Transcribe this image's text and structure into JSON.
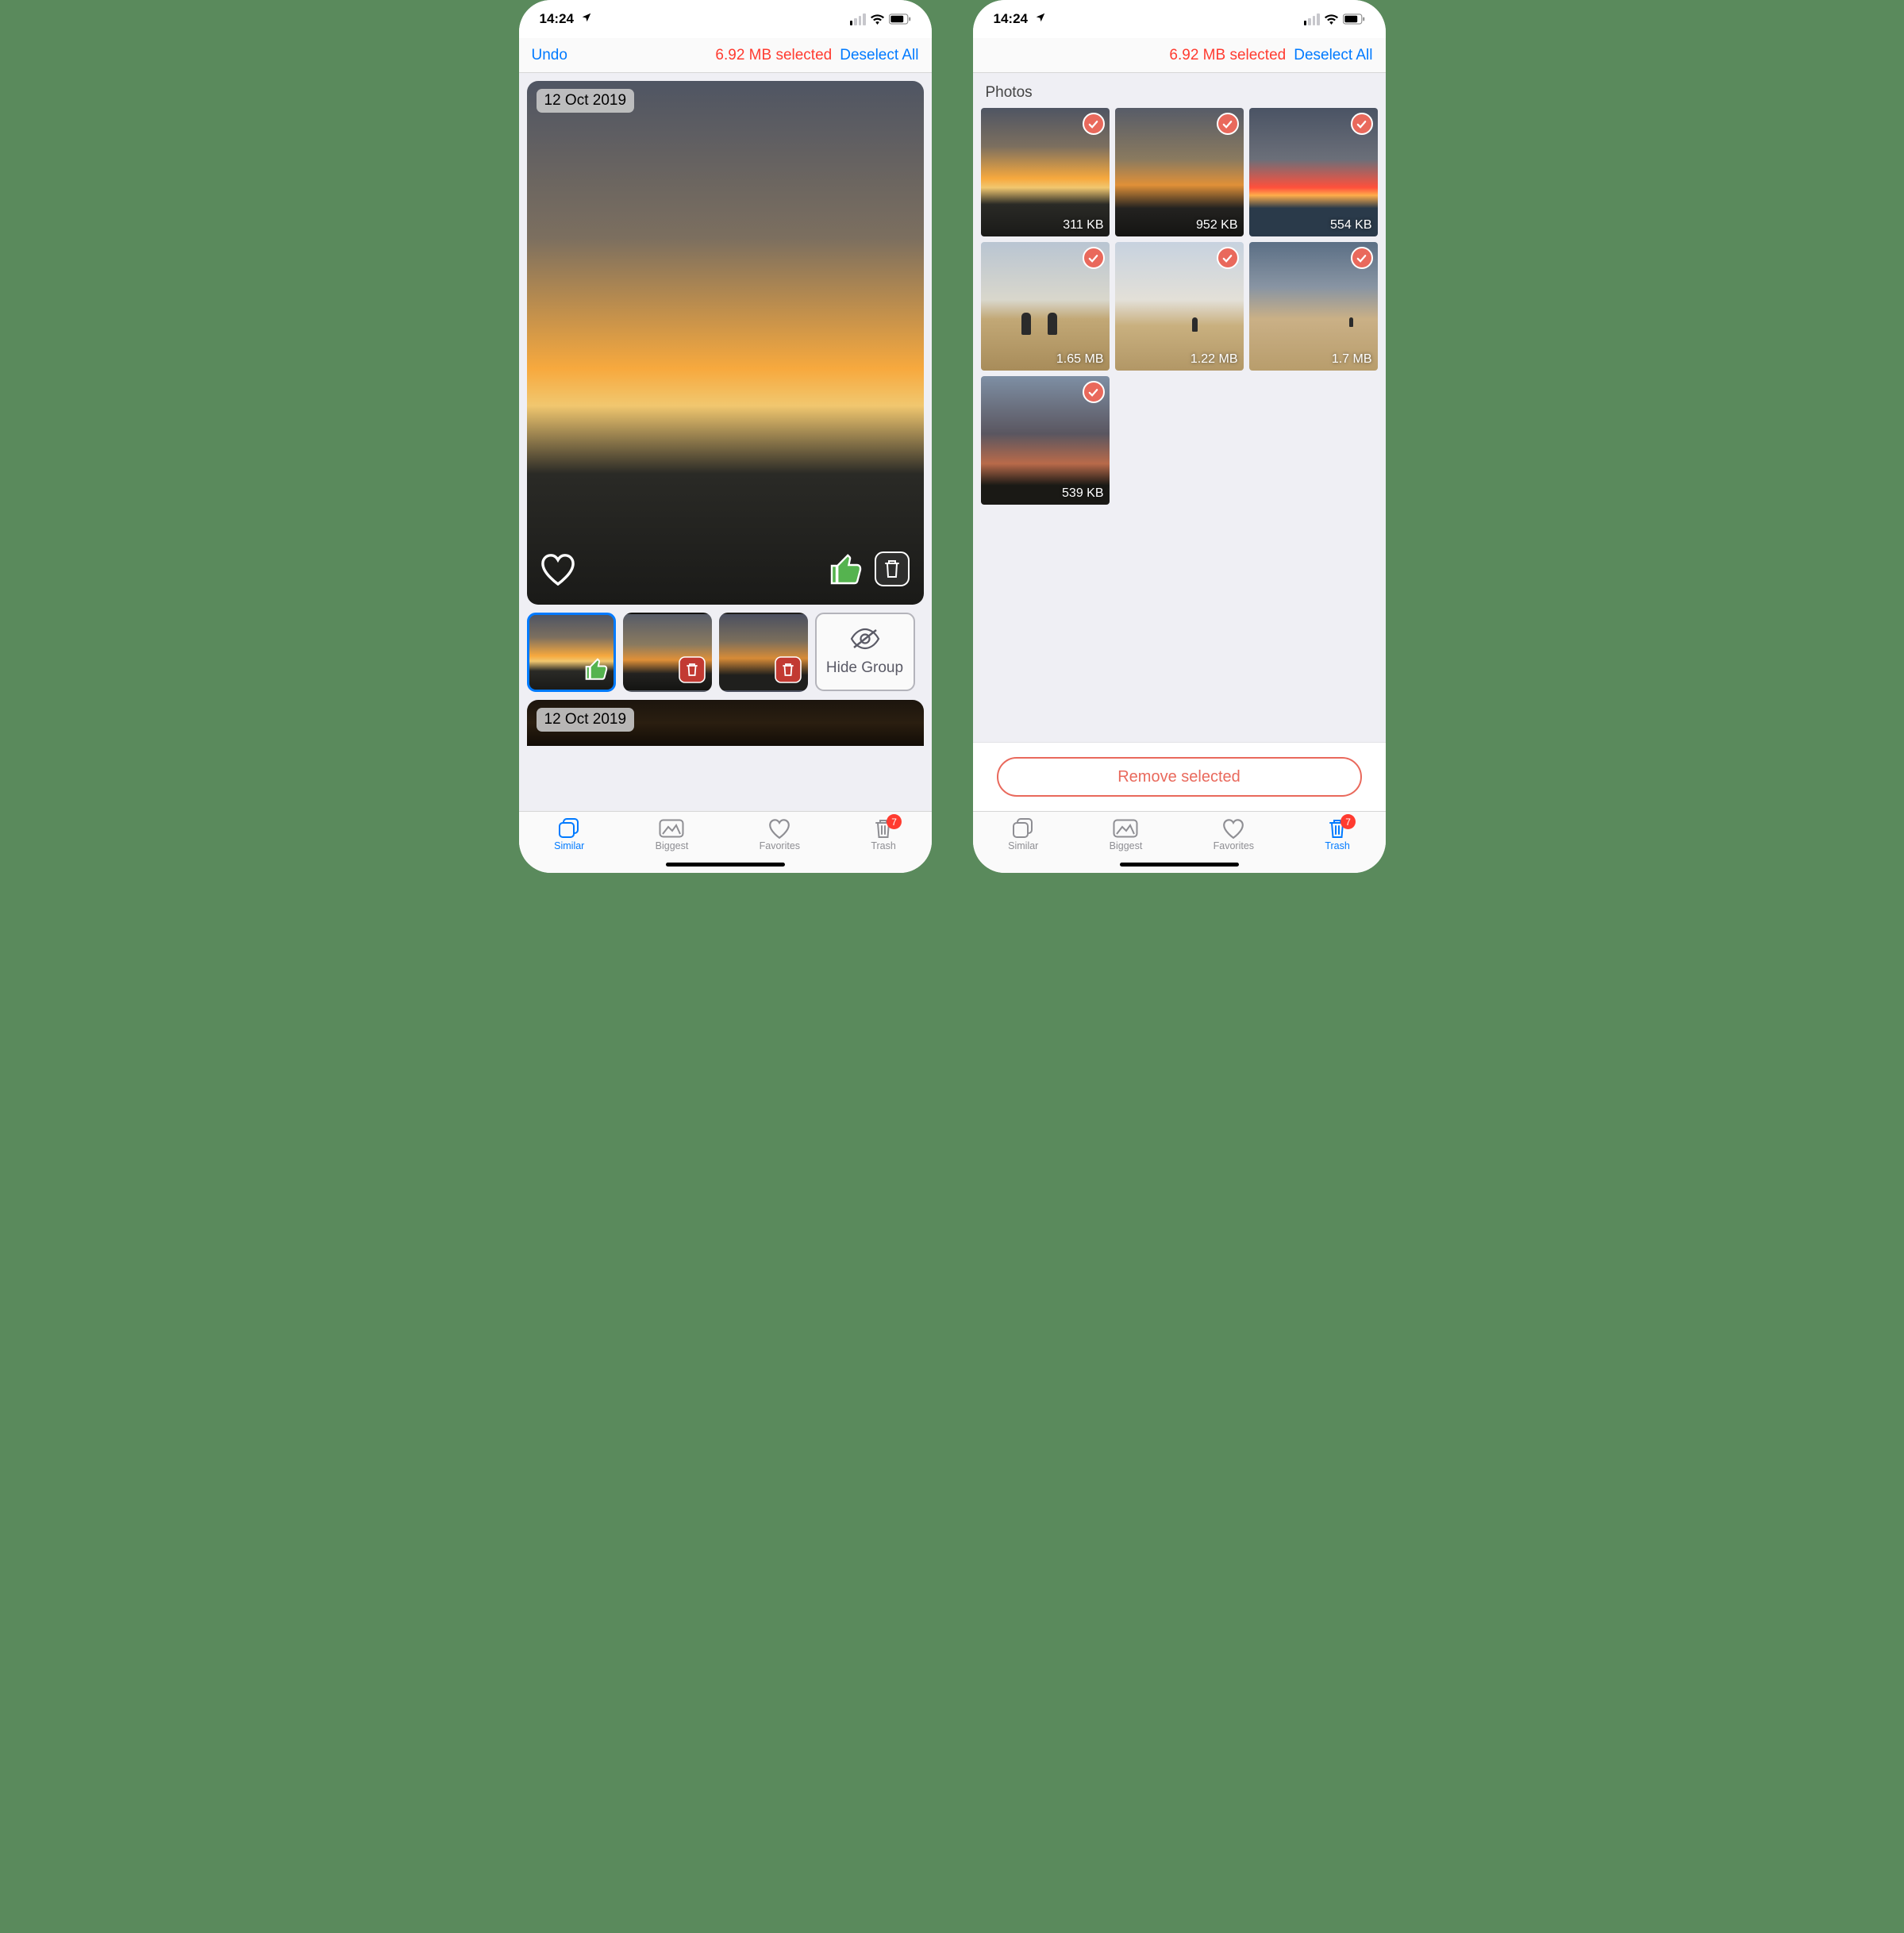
{
  "status": {
    "time": "14:24",
    "signal_bars_on": 1,
    "signal_bars_total": 4
  },
  "left": {
    "undo": "Undo",
    "selected_summary": "6.92 MB selected",
    "deselect": "Deselect All",
    "group1_date": "12 Oct 2019",
    "hide_group": "Hide Group",
    "group2_date": "12 Oct 2019",
    "thumbs": [
      {
        "state": "keep"
      },
      {
        "state": "trash"
      },
      {
        "state": "trash"
      }
    ]
  },
  "right": {
    "selected_summary": "6.92 MB selected",
    "deselect": "Deselect All",
    "section": "Photos",
    "remove_label": "Remove selected",
    "items": [
      {
        "size": "311 KB"
      },
      {
        "size": "952 KB"
      },
      {
        "size": "554 KB"
      },
      {
        "size": "1.65 MB"
      },
      {
        "size": "1.22 MB"
      },
      {
        "size": "1.7 MB"
      },
      {
        "size": "539 KB"
      }
    ]
  },
  "tabs": {
    "similar": "Similar",
    "biggest": "Biggest",
    "favorites": "Favorites",
    "trash": "Trash",
    "trash_badge": "7"
  }
}
